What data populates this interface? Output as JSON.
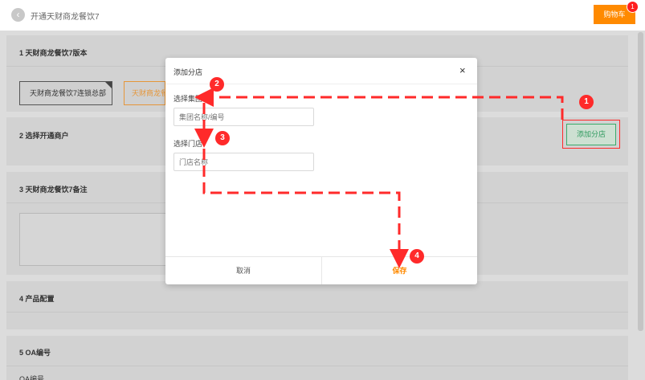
{
  "header": {
    "back_icon": "chevron-left-icon",
    "title": "开通天财商龙餐饮7",
    "cart_label": "购物车",
    "cart_count": "1"
  },
  "sections": {
    "s1_title": "1 天财商龙餐饮7版本",
    "s1_tag_a": "天财商龙餐饮7连锁总部",
    "s1_tag_b": "天财商龙餐",
    "s2_title": "2 选择开通商户",
    "s2_add_branch": "添加分店",
    "s3_title": "3 天财商龙餐饮7备注",
    "s4_title": "4 产品配置",
    "s5_title": "5 OA编号",
    "s5_sub": "OA编号"
  },
  "modal": {
    "title": "添加分店",
    "close": "×",
    "group_label": "选择集团",
    "group_placeholder": "集团名称/编号",
    "store_label": "选择门店",
    "store_placeholder": "门店名称",
    "cancel": "取消",
    "save": "保存"
  },
  "annotations": {
    "step1": "1",
    "step2": "2",
    "step3": "3",
    "step4": "4",
    "color": "#ff2a2a"
  },
  "colors": {
    "accent": "#ff8a00",
    "success": "#2e9a5e",
    "danger": "#ff2a2a"
  }
}
